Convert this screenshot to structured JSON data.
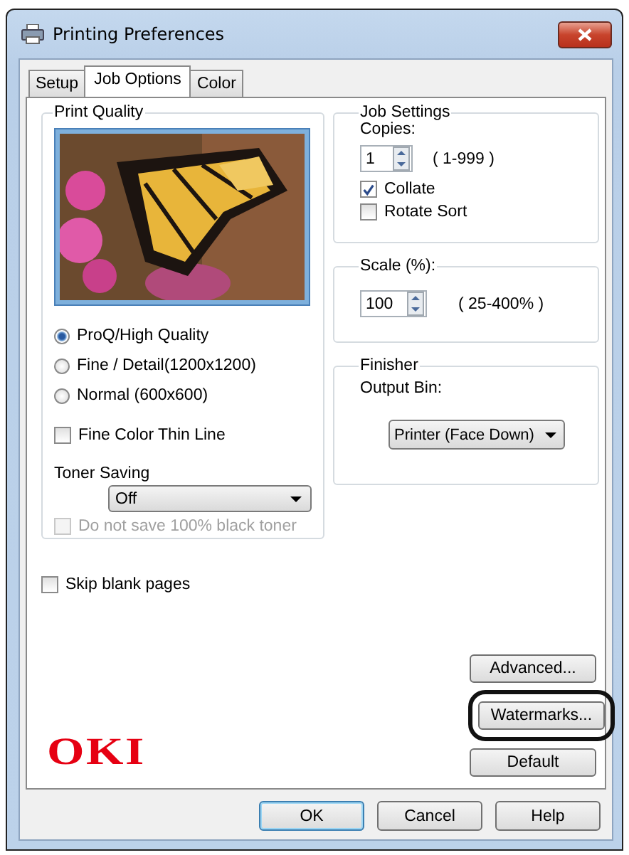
{
  "window": {
    "title": "Printing Preferences"
  },
  "tabs": [
    {
      "label": "Setup",
      "selected": false
    },
    {
      "label": "Job Options",
      "selected": true
    },
    {
      "label": "Color",
      "selected": false
    }
  ],
  "print_quality": {
    "title": "Print Quality",
    "options": [
      {
        "label": "ProQ/High Quality",
        "selected": true
      },
      {
        "label": "Fine / Detail(1200x1200)",
        "selected": false
      },
      {
        "label": "Normal (600x600)",
        "selected": false
      }
    ],
    "fine_color_thin_line": {
      "label": "Fine Color Thin Line",
      "checked": false
    },
    "toner_saving": {
      "label": "Toner Saving",
      "value": "Off"
    },
    "black_toner": {
      "label": "Do not save 100% black toner",
      "checked": false,
      "disabled": true
    }
  },
  "job_settings": {
    "title": "Job Settings",
    "copies_label": "Copies:",
    "copies_value": "1",
    "copies_range": "( 1-999 )",
    "options": [
      {
        "label": "Collate",
        "checked": true
      },
      {
        "label": "Rotate Sort",
        "checked": false
      }
    ]
  },
  "scale": {
    "title": "Scale (%):",
    "value": "100",
    "range": "( 25-400% )"
  },
  "finisher": {
    "title": "Finisher",
    "output_bin_label": "Output Bin:",
    "output_bin": "Printer (Face Down)"
  },
  "skip_blank_pages": {
    "label": "Skip blank pages",
    "checked": false
  },
  "side_buttons": [
    {
      "label": "Advanced...",
      "highlighted": false
    },
    {
      "label": "Watermarks...",
      "highlighted": true
    },
    {
      "label": "Default",
      "highlighted": false
    }
  ],
  "logo": "OKI",
  "buttons": [
    {
      "label": "OK",
      "default": true
    },
    {
      "label": "Cancel",
      "default": false
    },
    {
      "label": "Help",
      "default": false
    }
  ]
}
